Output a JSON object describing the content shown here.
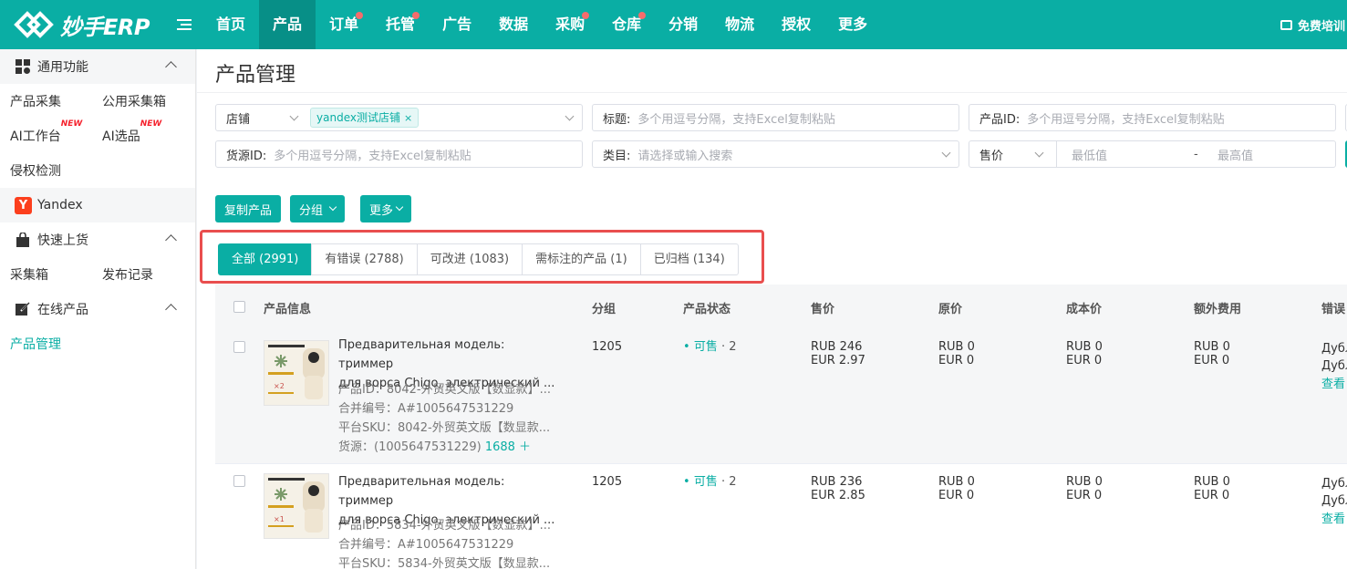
{
  "header": {
    "logo_text": "妙手ERP",
    "nav": [
      {
        "label": "首页",
        "active": false,
        "dot": false
      },
      {
        "label": "产品",
        "active": true,
        "dot": false
      },
      {
        "label": "订单",
        "active": false,
        "dot": true
      },
      {
        "label": "托管",
        "active": false,
        "dot": true
      },
      {
        "label": "广告",
        "active": false,
        "dot": false
      },
      {
        "label": "数据",
        "active": false,
        "dot": false
      },
      {
        "label": "采购",
        "active": false,
        "dot": true
      },
      {
        "label": "仓库",
        "active": false,
        "dot": true
      },
      {
        "label": "分销",
        "active": false,
        "dot": false
      },
      {
        "label": "物流",
        "active": false,
        "dot": false
      },
      {
        "label": "授权",
        "active": false,
        "dot": false
      },
      {
        "label": "更多",
        "active": false,
        "dot": false
      }
    ],
    "right_label": "免费培训",
    "accent": "#0aaea4"
  },
  "sidebar": {
    "general": {
      "title": "通用功能"
    },
    "general_items": {
      "collect": "产品采集",
      "public_box": "公用采集箱",
      "ai_workbench": "AI工作台",
      "ai_select": "AI选品",
      "new_badge": "NEW",
      "infringe": "侵权检测"
    },
    "platform": "Yandex",
    "platform_icon": "Y",
    "quick": {
      "title": "快速上货"
    },
    "quick_items": {
      "box": "采集箱",
      "records": "发布记录"
    },
    "online": {
      "title": "在线产品"
    },
    "online_items": {
      "manage": "产品管理"
    }
  },
  "main": {
    "title": "产品管理",
    "filters": {
      "store_label": "店铺",
      "store_tag": "yandex测试店铺",
      "title_label": "标题:",
      "title_placeholder": "多个用逗号分隔，支持Excel复制粘贴",
      "pid_label": "产品ID:",
      "pid_placeholder": "多个用逗号分隔，支持Excel复制粘贴",
      "source_label": "货源ID:",
      "source_placeholder": "多个用逗号分隔，支持Excel复制粘贴",
      "category_label": "类目:",
      "category_placeholder": "请选择或输入搜索",
      "price_label": "售价",
      "min_placeholder": "最低值",
      "range_sep": "-",
      "max_placeholder": "最高值"
    },
    "buttons": {
      "copy": "复制产品",
      "group": "分组",
      "more": "更多"
    },
    "tabs": [
      {
        "label": "全部 (2991)",
        "active": true
      },
      {
        "label": "有错误 (2788)",
        "active": false
      },
      {
        "label": "可改进 (1083)",
        "active": false
      },
      {
        "label": "需标注的产品 (1)",
        "active": false
      },
      {
        "label": "已归档 (134)",
        "active": false
      }
    ],
    "columns": {
      "info": "产品信息",
      "group": "分组",
      "status": "产品状态",
      "price": "售价",
      "orig": "原价",
      "cost": "成本价",
      "extra": "额外费用",
      "error": "错误"
    },
    "rows": [
      {
        "thumb_qty": "×2",
        "name1": "Предварительная модель: триммер",
        "name2": "для ворса Chigo, электрический ...",
        "pid": "产品ID：8042-外贸英文版【数显款】...",
        "merge": "合并编号：A#1005647531229",
        "sku": "平台SKU：8042-外贸英文版【数显款...",
        "source": "货源：(1005647531229)",
        "source_link": "1688 ＋",
        "group": "1205",
        "status": "可售",
        "status_count": "· 2",
        "price1": "RUB 246",
        "price2": "EUR 2.97",
        "orig1": "RUB 0",
        "orig2": "EUR 0",
        "cost1": "RUB 0",
        "cost2": "EUR 0",
        "extra1": "RUB 0",
        "extra2": "EUR 0",
        "err1": "Дубл",
        "err2": "Дубл",
        "view": "查看"
      },
      {
        "thumb_qty": "×1",
        "name1": "Предварительная модель: триммер",
        "name2": "для ворса Chigo, электрический ...",
        "pid": "产品ID：5834-外贸英文版【数显款】...",
        "merge": "合并编号：A#1005647531229",
        "sku": "平台SKU：5834-外贸英文版【数显款...",
        "group": "1205",
        "status": "可售",
        "status_count": "· 2",
        "price1": "RUB 236",
        "price2": "EUR 2.85",
        "orig1": "RUB 0",
        "orig2": "EUR 0",
        "cost1": "RUB 0",
        "cost2": "EUR 0",
        "extra1": "RUB 0",
        "extra2": "EUR 0",
        "err1": "Дубл",
        "err2": "Дубл",
        "view": "查看"
      }
    ]
  }
}
